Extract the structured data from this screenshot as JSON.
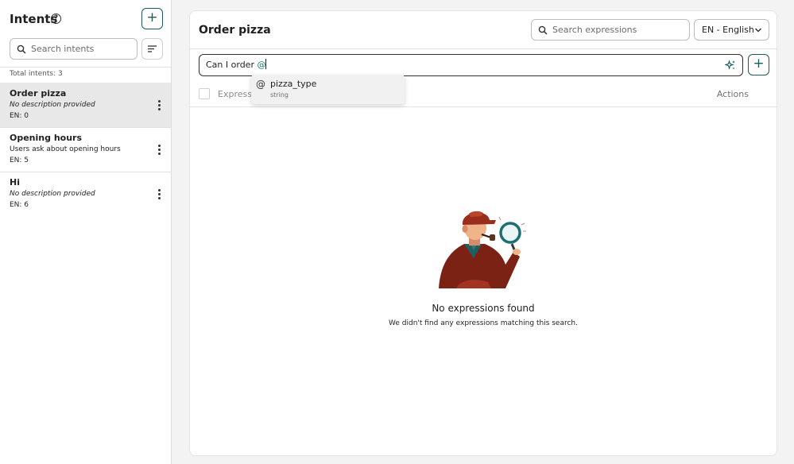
{
  "sidebar": {
    "title": "Intents",
    "search_placeholder": "Search intents",
    "total_label": "Total intents: 3",
    "items": [
      {
        "name": "Order pizza",
        "description": "No description provided",
        "count": "EN: 0",
        "active": true
      },
      {
        "name": "Opening hours",
        "description": "Users ask about opening hours",
        "count": "EN: 5",
        "active": false
      },
      {
        "name": "Hi",
        "description": "No description provided",
        "count": "EN: 6",
        "active": false
      }
    ]
  },
  "main": {
    "title": "Order pizza",
    "search_placeholder": "Search expressions",
    "language": "EN - English",
    "expression_text": "Can I order ",
    "expression_at": "@",
    "table": {
      "col_expression": "Expressions",
      "col_actions": "Actions"
    },
    "autocomplete": {
      "symbol": "@",
      "name": "pizza_type",
      "type": "string"
    },
    "empty": {
      "title": "No expressions found",
      "subtitle": "We didn't find any expressions matching this search."
    }
  },
  "colors": {
    "accent": "#1b5a5e",
    "active_row": "#e8e8e8"
  }
}
